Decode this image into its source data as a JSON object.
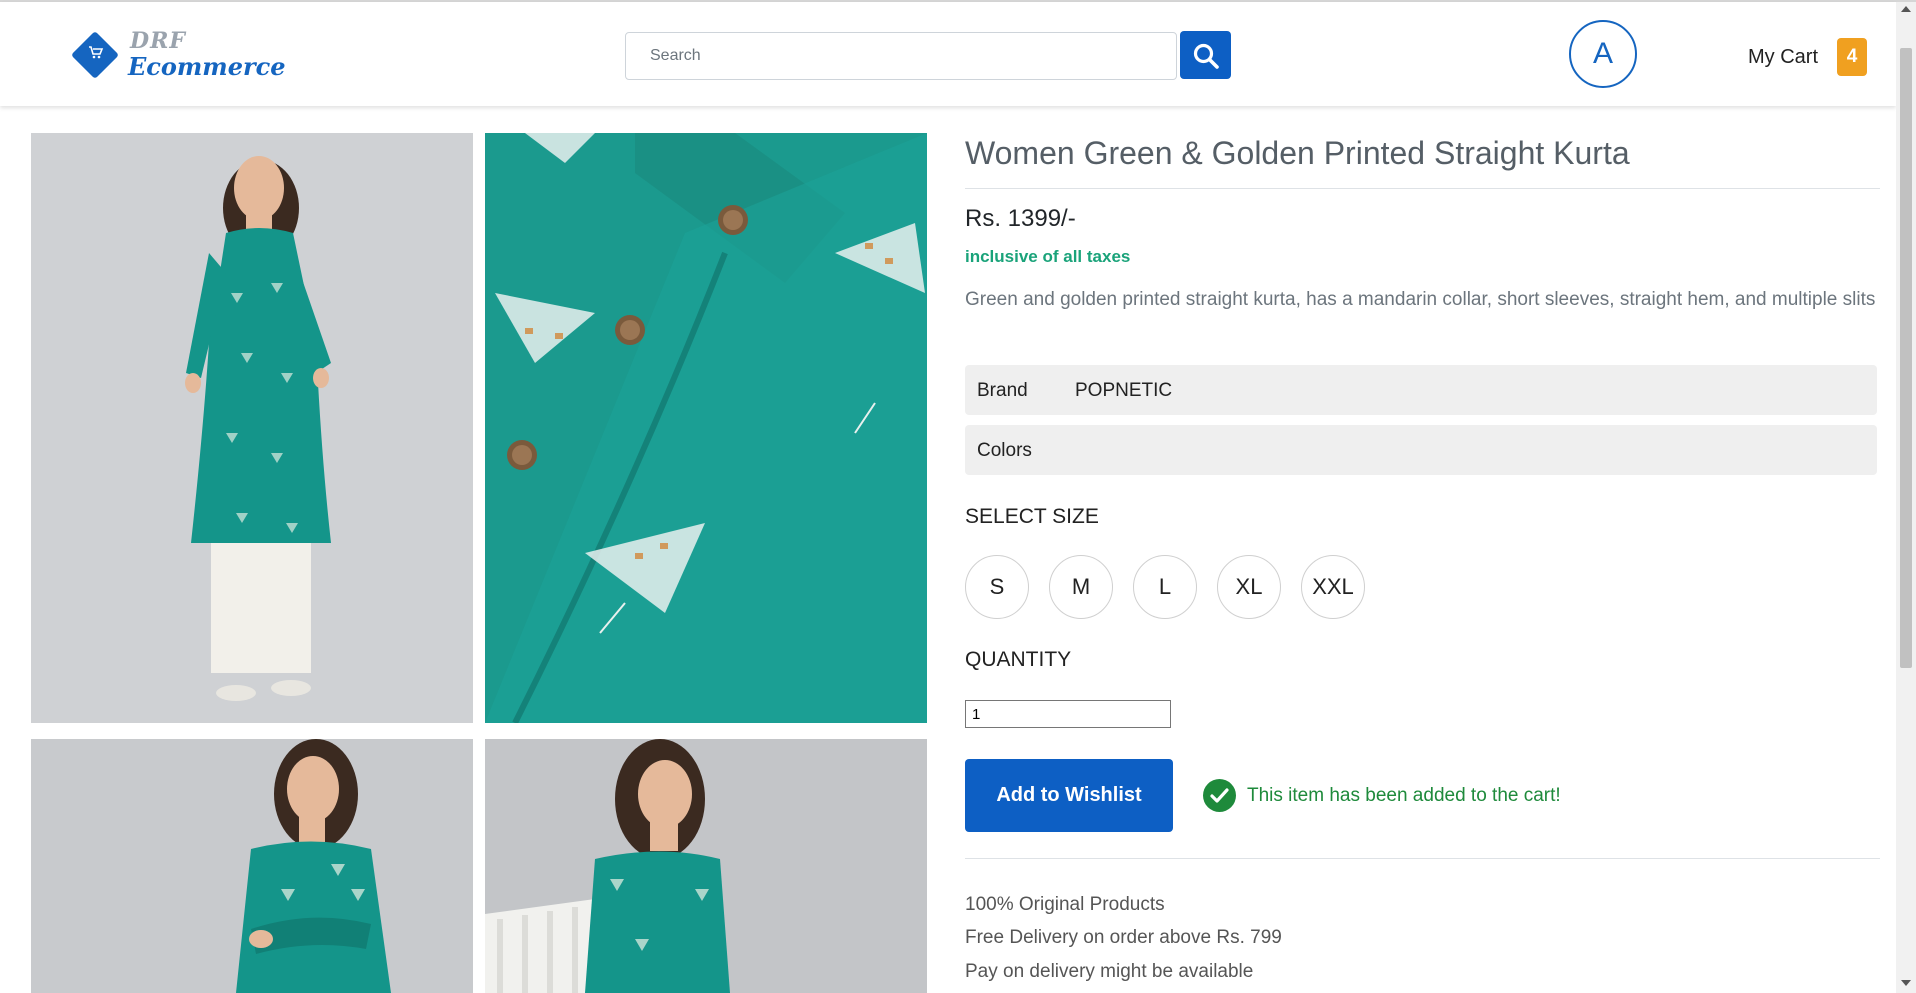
{
  "header": {
    "logo": {
      "line1": "DRF",
      "line2": "Ecommerce"
    },
    "search": {
      "placeholder": "Search"
    },
    "avatar_letter": "A",
    "cart": {
      "label": "My Cart",
      "count": "4"
    }
  },
  "gallery": {
    "images": [
      "model-full-length",
      "fabric-closeup",
      "model-arms-crossed",
      "model-seated"
    ]
  },
  "product": {
    "title": "Women Green & Golden Printed Straight Kurta",
    "price": "Rs. 1399/-",
    "taxes_note": "inclusive of all taxes",
    "description": "Green and golden printed straight kurta, has a mandarin collar, short sleeves, straight hem, and multiple slits",
    "specs": [
      {
        "key": "Brand",
        "value": "POPNETIC"
      },
      {
        "key": "Colors",
        "value": ""
      }
    ],
    "size_heading": "SELECT SIZE",
    "sizes": [
      "S",
      "M",
      "L",
      "XL",
      "XXL"
    ],
    "quantity_heading": "QUANTITY",
    "quantity_value": "1",
    "wishlist_button": "Add to Wishlist",
    "added_message": "This item has been added to the cart!",
    "info": [
      "100% Original Products",
      "Free Delivery on order above Rs. 799",
      "Pay on delivery might be available"
    ]
  },
  "colors": {
    "brand_blue": "#0d5fc4",
    "badge_orange": "#f0a020",
    "success_green": "#1e8a3b",
    "taxes_green": "#1aa37a",
    "kurta_teal": "#1b9a8e"
  }
}
